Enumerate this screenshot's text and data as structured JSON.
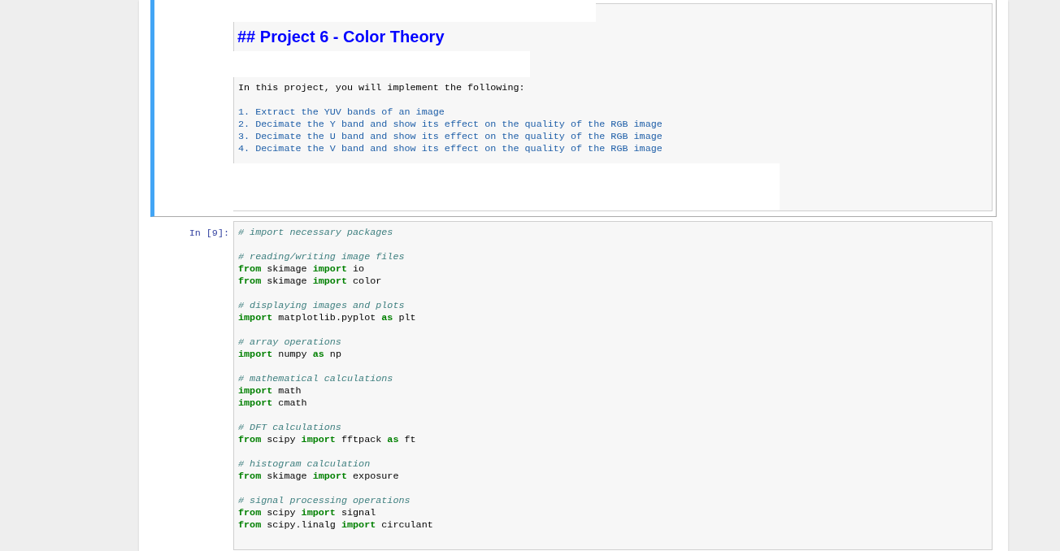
{
  "cells": [
    {
      "kind": "markdown",
      "selected": true,
      "heading": "## Project 6 - Color Theory",
      "intro": "In this project, you will implement the following:",
      "items": [
        "1. Extract the YUV bands of an image",
        "2. Decimate the Y band and show its effect on the quality of the RGB image",
        "3. Decimate the U band and show its effect on the quality of the RGB image",
        "4. Decimate the V band and show its effect on the quality of the RGB image"
      ]
    },
    {
      "kind": "code",
      "selected": false,
      "prompt": "In [9]:",
      "lines": [
        {
          "kind": "comment",
          "text": "# import necessary packages"
        },
        {
          "kind": "blank"
        },
        {
          "kind": "comment",
          "text": "# reading/writing image files"
        },
        {
          "kind": "code",
          "tokens": [
            {
              "kind": "keyword",
              "text": "from"
            },
            {
              "kind": "plain",
              "text": " skimage "
            },
            {
              "kind": "keyword",
              "text": "import"
            },
            {
              "kind": "plain",
              "text": " io"
            }
          ]
        },
        {
          "kind": "code",
          "tokens": [
            {
              "kind": "keyword",
              "text": "from"
            },
            {
              "kind": "plain",
              "text": " skimage "
            },
            {
              "kind": "keyword",
              "text": "import"
            },
            {
              "kind": "plain",
              "text": " color"
            }
          ]
        },
        {
          "kind": "blank"
        },
        {
          "kind": "comment",
          "text": "# displaying images and plots"
        },
        {
          "kind": "code",
          "tokens": [
            {
              "kind": "keyword",
              "text": "import"
            },
            {
              "kind": "plain",
              "text": " matplotlib.pyplot "
            },
            {
              "kind": "keyword",
              "text": "as"
            },
            {
              "kind": "plain",
              "text": " plt"
            }
          ]
        },
        {
          "kind": "blank"
        },
        {
          "kind": "comment",
          "text": "# array operations"
        },
        {
          "kind": "code",
          "tokens": [
            {
              "kind": "keyword",
              "text": "import"
            },
            {
              "kind": "plain",
              "text": " numpy "
            },
            {
              "kind": "keyword",
              "text": "as"
            },
            {
              "kind": "plain",
              "text": " np"
            }
          ]
        },
        {
          "kind": "blank"
        },
        {
          "kind": "comment",
          "text": "# mathematical calculations"
        },
        {
          "kind": "code",
          "tokens": [
            {
              "kind": "keyword",
              "text": "import"
            },
            {
              "kind": "plain",
              "text": " math"
            }
          ]
        },
        {
          "kind": "code",
          "tokens": [
            {
              "kind": "keyword",
              "text": "import"
            },
            {
              "kind": "plain",
              "text": " cmath"
            }
          ]
        },
        {
          "kind": "blank"
        },
        {
          "kind": "comment",
          "text": "# DFT calculations"
        },
        {
          "kind": "code",
          "tokens": [
            {
              "kind": "keyword",
              "text": "from"
            },
            {
              "kind": "plain",
              "text": " scipy "
            },
            {
              "kind": "keyword",
              "text": "import"
            },
            {
              "kind": "plain",
              "text": " fftpack "
            },
            {
              "kind": "keyword",
              "text": "as"
            },
            {
              "kind": "plain",
              "text": " ft"
            }
          ]
        },
        {
          "kind": "blank"
        },
        {
          "kind": "comment",
          "text": "# histogram calculation"
        },
        {
          "kind": "code",
          "tokens": [
            {
              "kind": "keyword",
              "text": "from"
            },
            {
              "kind": "plain",
              "text": " skimage "
            },
            {
              "kind": "keyword",
              "text": "import"
            },
            {
              "kind": "plain",
              "text": " exposure"
            }
          ]
        },
        {
          "kind": "blank"
        },
        {
          "kind": "comment",
          "text": "# signal processing operations"
        },
        {
          "kind": "code",
          "tokens": [
            {
              "kind": "keyword",
              "text": "from"
            },
            {
              "kind": "plain",
              "text": " scipy "
            },
            {
              "kind": "keyword",
              "text": "import"
            },
            {
              "kind": "plain",
              "text": " signal"
            }
          ]
        },
        {
          "kind": "code",
          "tokens": [
            {
              "kind": "keyword",
              "text": "from"
            },
            {
              "kind": "plain",
              "text": " scipy.linalg "
            },
            {
              "kind": "keyword",
              "text": "import"
            },
            {
              "kind": "plain",
              "text": " circulant"
            }
          ]
        }
      ]
    }
  ]
}
